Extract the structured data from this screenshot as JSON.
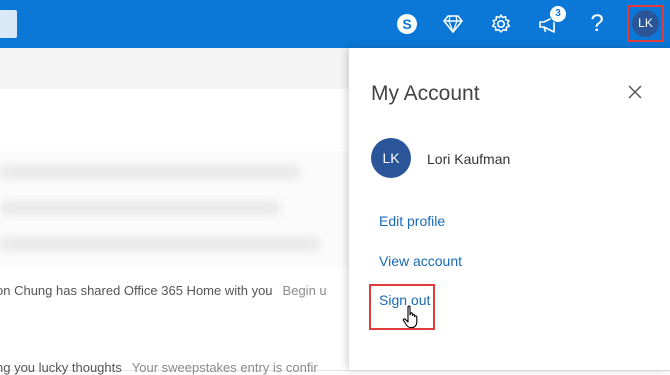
{
  "toolbar": {
    "notification_count": "3",
    "help_label": "?",
    "user_initials": "LK",
    "icons": [
      "skype-icon",
      "diamond-icon",
      "gear-icon",
      "megaphone-icon",
      "help-icon"
    ]
  },
  "background": {
    "mail_item_1": {
      "sender_text": "on Chung has shared Office 365 Home with you",
      "preview": "Begin u"
    },
    "mail_item_2": {
      "sender_text": "ng you lucky thoughts",
      "preview": "Your sweepstakes entry is confir"
    }
  },
  "account_panel": {
    "title": "My Account",
    "avatar_initials": "LK",
    "user_name": "Lori Kaufman",
    "links": {
      "edit_profile": "Edit profile",
      "view_account": "View account",
      "sign_out": "Sign out"
    }
  },
  "colors": {
    "topbar": "#0b78d7",
    "avatar": "#2a5699",
    "link": "#1a6ab8",
    "highlight": "#e03c3c"
  }
}
